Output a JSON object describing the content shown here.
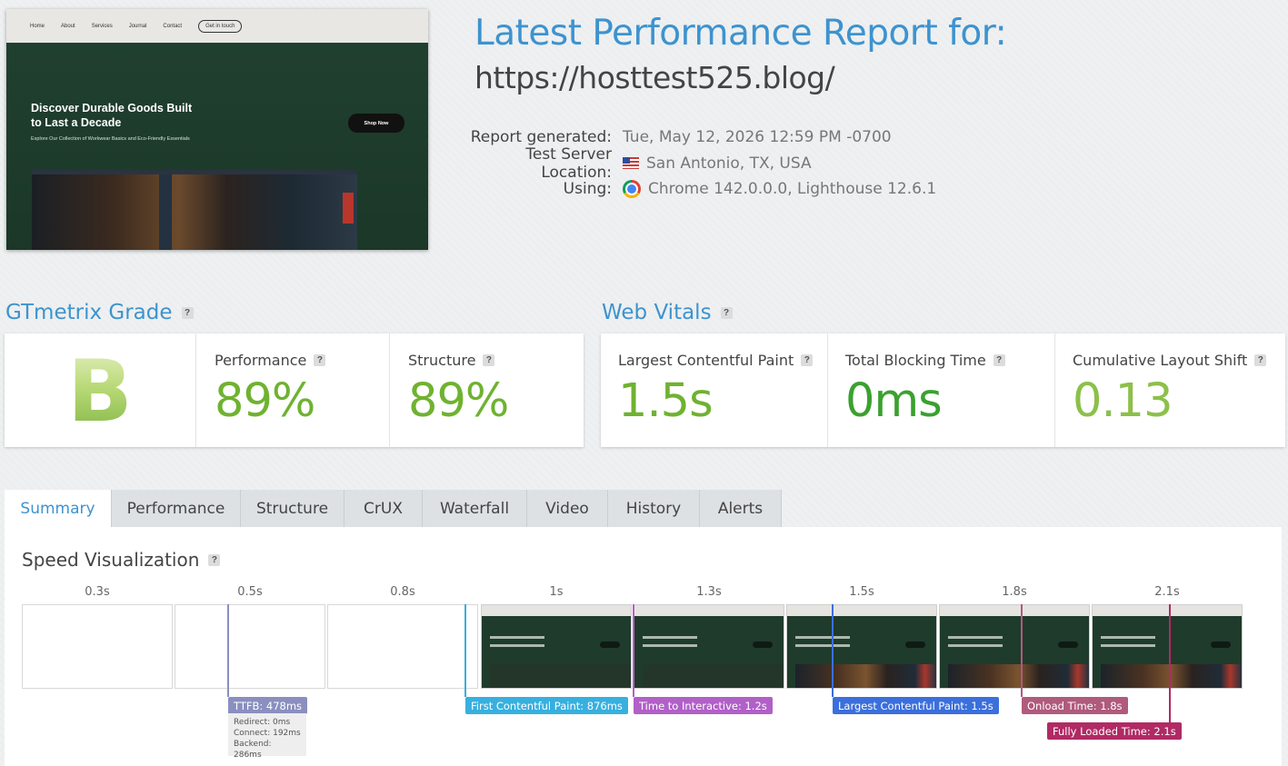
{
  "thumbnail": {
    "nav": [
      "Home",
      "About",
      "Services",
      "Journal",
      "Contact"
    ],
    "nav_cta": "Get in touch",
    "hero_title": "Discover Durable Goods Built to Last a Decade",
    "hero_subtitle": "Explore Our Collection of Workwear Basics and Eco-Friendly Essentials",
    "hero_button": "Shop Now"
  },
  "header": {
    "title": "Latest Performance Report for:",
    "url": "https://hosttest525.blog/"
  },
  "meta": {
    "generated_label": "Report generated:",
    "generated_value": "Tue, May 12, 2026 12:59 PM -0700",
    "location_label": "Test Server Location:",
    "location_value": "San Antonio, TX, USA",
    "using_label": "Using:",
    "using_value": "Chrome 142.0.0.0, Lighthouse 12.6.1"
  },
  "grade": {
    "heading": "GTmetrix Grade",
    "letter": "B",
    "performance_label": "Performance",
    "performance_value": "89%",
    "structure_label": "Structure",
    "structure_value": "89%"
  },
  "vitals": {
    "heading": "Web Vitals",
    "lcp_label": "Largest Contentful Paint",
    "lcp_value": "1.5s",
    "tbt_label": "Total Blocking Time",
    "tbt_value": "0ms",
    "cls_label": "Cumulative Layout Shift",
    "cls_value": "0.13"
  },
  "help_mark": "?",
  "tabs": [
    {
      "label": "Summary"
    },
    {
      "label": "Performance"
    },
    {
      "label": "Structure"
    },
    {
      "label": "CrUX"
    },
    {
      "label": "Waterfall"
    },
    {
      "label": "Video"
    },
    {
      "label": "History"
    },
    {
      "label": "Alerts"
    }
  ],
  "speed": {
    "title": "Speed Visualization",
    "frames": [
      "0.3s",
      "0.5s",
      "0.8s",
      "1s",
      "1.3s",
      "1.5s",
      "1.8s",
      "2.1s"
    ],
    "ttfb": "TTFB: 478ms",
    "ttfb_details": [
      "Redirect: 0ms",
      "Connect: 192ms",
      "Backend: 286ms"
    ],
    "fcp": "First Contentful Paint: 876ms",
    "tti": "Time to Interactive: 1.2s",
    "lcp": "Largest Contentful Paint: 1.5s",
    "onload": "Onload Time: 1.8s",
    "fully_loaded": "Fully Loaded Time: 2.1s"
  },
  "colors": {
    "accent": "#3d93cf",
    "grade_green": "#6fb230",
    "ttfb": "#8a8fbf",
    "fcp": "#37b0df",
    "tti": "#b160c8",
    "lcp": "#3b6fdc",
    "onload": "#b05a7c",
    "fully_loaded": "#b02a64"
  }
}
